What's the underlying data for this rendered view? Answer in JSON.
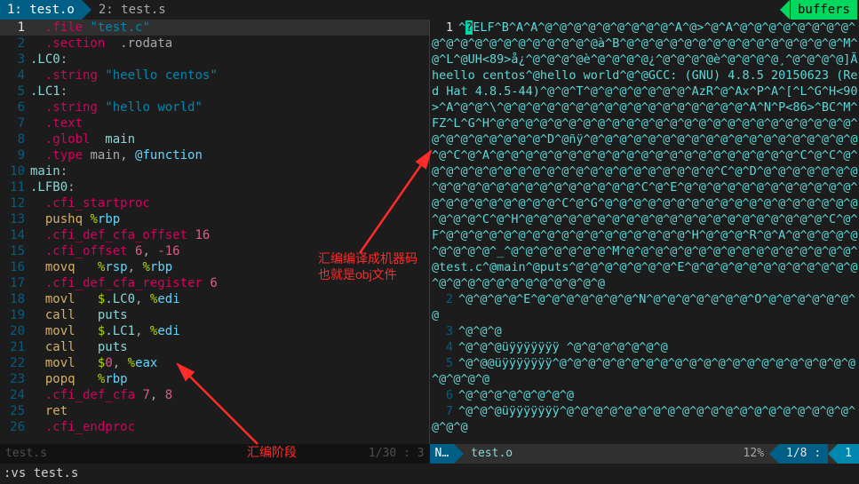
{
  "tabs": {
    "active": "1: test.o",
    "inactive": "2: test.s",
    "buffers": "buffers"
  },
  "left": {
    "filename": "test.s",
    "pos": "1/30 :  3",
    "lines": [
      {
        "n": 1,
        "html": "  <span class='kw'>.file</span> <span class='str'>\"test.c\"</span>"
      },
      {
        "n": 2,
        "html": "  <span class='kw'>.section</span>  <span class='plain'>.rodata</span>"
      },
      {
        "n": 3,
        "html": "<span class='lbl'>.LC0</span><span class='plain'>:</span>"
      },
      {
        "n": 4,
        "html": "  <span class='kw'>.string</span> <span class='str'>\"heello centos\"</span>"
      },
      {
        "n": 5,
        "html": "<span class='lbl'>.LC1</span><span class='plain'>:</span>"
      },
      {
        "n": 6,
        "html": "  <span class='kw'>.string</span> <span class='str'>\"hello world\"</span>"
      },
      {
        "n": 7,
        "html": "  <span class='kw'>.text</span>"
      },
      {
        "n": 8,
        "html": "  <span class='kw'>.globl</span>  <span class='sym'>main</span>"
      },
      {
        "n": 9,
        "html": "  <span class='kw'>.type</span> <span class='plain'>main,</span> <span class='type'>@function</span>"
      },
      {
        "n": 10,
        "html": "<span class='sym'>main</span><span class='plain'>:</span>"
      },
      {
        "n": 11,
        "html": "<span class='lbl'>.LFB0</span><span class='plain'>:</span>"
      },
      {
        "n": 12,
        "html": "  <span class='kw'>.cfi_startproc</span>"
      },
      {
        "n": 13,
        "html": "  <span class='op'>pushq</span> <span class='reg'>%</span><span class='reg2'>rbp</span>"
      },
      {
        "n": 14,
        "html": "  <span class='kw'>.cfi_def_cfa_offset</span> <span class='num'>16</span>"
      },
      {
        "n": 15,
        "html": "  <span class='kw'>.cfi_offset</span> <span class='num'>6</span><span class='plain'>,</span> <span class='num'>-16</span>"
      },
      {
        "n": 16,
        "html": "  <span class='op'>movq</span>   <span class='reg'>%</span><span class='reg2'>rsp</span><span class='plain'>,</span> <span class='reg'>%</span><span class='reg2'>rbp</span>"
      },
      {
        "n": 17,
        "html": "  <span class='kw'>.cfi_def_cfa_register</span> <span class='num'>6</span>"
      },
      {
        "n": 18,
        "html": "  <span class='op'>movl</span>   <span class='reg'>$</span><span class='lbl'>.LC0</span><span class='plain'>,</span> <span class='reg'>%</span><span class='reg2'>edi</span>"
      },
      {
        "n": 19,
        "html": "  <span class='op'>call</span>   <span class='sym'>puts</span>"
      },
      {
        "n": 20,
        "html": "  <span class='op'>movl</span>   <span class='reg'>$</span><span class='lbl'>.LC1</span><span class='plain'>,</span> <span class='reg'>%</span><span class='reg2'>edi</span>"
      },
      {
        "n": 21,
        "html": "  <span class='op'>call</span>   <span class='sym'>puts</span>"
      },
      {
        "n": 22,
        "html": "  <span class='op'>movl</span>   <span class='reg'>$</span><span class='num'>0</span><span class='plain'>,</span> <span class='reg'>%</span><span class='reg2'>eax</span>"
      },
      {
        "n": 23,
        "html": "  <span class='op'>popq</span>   <span class='reg'>%</span><span class='reg2'>rbp</span>"
      },
      {
        "n": 24,
        "html": "  <span class='kw'>.cfi_def_cfa</span> <span class='num'>7</span><span class='plain'>,</span> <span class='num'>8</span>"
      },
      {
        "n": 25,
        "html": "  <span class='op'>ret</span>"
      },
      {
        "n": 26,
        "html": "  <span class='kw'>.cfi_endproc</span>"
      }
    ]
  },
  "right": {
    "filename": "test.o",
    "mode": "N…",
    "percent": "12%",
    "pos": "1/8 :",
    "col": "1",
    "lines": [
      {
        "n": 1,
        "t": "^?ELF^B^A^A^@^@^@^@^@^@^@^@^@^A^@>^@^A^@^@^@^@^@^@^@^@^@^@^@^@^@^@^@^@^@^@^@^@à^B^@^@^@^@^@^@^@^@^@^@^@^@^@^@^@^M^@^L^@UH<89>å¿^@^@^@^@è^@^@^@^@¿^@^@^@^@è^@^@^@^@¸^@^@^@^@]Ãheello centos^@hello world^@^@GCC: (GNU) 4.8.5 20150623 (Red Hat 4.8.5-44)^@^@^T^@^@^@^@^@^@^@^AzR^@^Ax^P^A^[^L^G^H<90>^A^@^@^\\^@^@^@^@^@^@^@^@^@^@^@^@^@^@^@^@^@^A^N^P<86>^BC^M^FZ^L^G^H^@^@^@^@^@^@^@^@^@^@^@^@^@^@^@^@^@^@^@^@^@^@^@^@^@^@^@^@^@^@^@^@^@^D^@ñÿ^@^@^@^@^@^@^@^@^@^@^@^@^@^@^@^@^@^@^@^@^C^@^A^@^@^@^@^@^@^@^@^@^@^@^@^@^@^@^@^@^@^@^@^@^C^@^C^@^@^@^@^@^@^@^@^@^@^@^@^@^@^@^@^@^@^@^@^@^C^@^D^@^@^@^@^@^@^@^@^@^@^@^@^@^@^@^@^@^@^@^@^@^C^@^E^@^@^@^@^@^@^@^@^@^@^@^@^@^@^@^@^@^@^@^@^@^C^@^G^@^@^@^@^@^@^@^@^@^@^@^@^@^@^@^@^@^@^@^@^@^C^@^H^@^@^@^@^@^@^@^@^@^@^@^@^@^@^@^@^@^@^@^@^@^C^@^F^@^@^@^@^@^@^@^@^@^@^@^@^@^@^@^@^@^H^@^@^@^R^@^A^@^@^@^@^@^@^@^@^@^_^@^@^@^@^@^@^@^M^@^@^@^@^@^@^@^@^@^@^@^@^@^@^@^@^@test.c^@main^@puts^@^@^@^@^@^@^@^E^@^@^@^@^@^@^@^@^@^@^@^@^@^@^@^@^@^@^@^@^@^@^@^@"
      },
      {
        "n": 2,
        "t": "^@^@^@^@^E^@^@^@^@^@^@^@^N^@^@^@^@^@^@^@^O^@^@^@^@^@^@^@"
      },
      {
        "n": 3,
        "t": "^@^@^@"
      },
      {
        "n": 4,
        "t": "^@^@^@üÿÿÿÿÿÿÿ ^@^@^@^@^@^@^@"
      },
      {
        "n": 5,
        "t": "^@^@@üÿÿÿÿÿÿÿ^@^@^@^@^@^@^@^@^@^@^@^@^@^@^@^@^@^@^@^@^@^@^@^@^@"
      },
      {
        "n": 6,
        "t": "^@^@^@^@^@^@^@^@"
      },
      {
        "n": 7,
        "t": "^@^@^@üÿÿÿÿÿÿÿ^@^@^@^@^@^@^@^@^@^@^@^@^@^@^@^@^@^@^@^@^@^@^@"
      }
    ]
  },
  "cmd": ":vs test.s",
  "annotations": {
    "label1": "汇编编译成机器码\n也就是obj文件",
    "label2": "汇编阶段"
  }
}
